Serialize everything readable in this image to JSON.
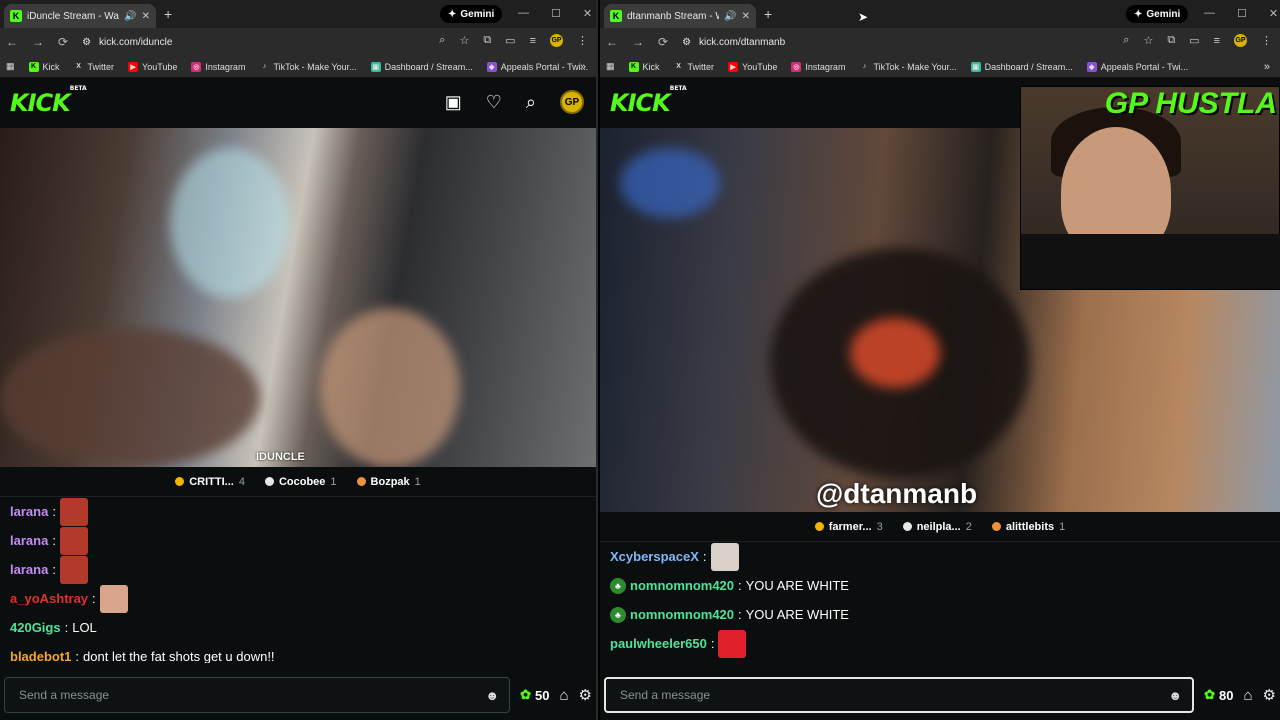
{
  "left": {
    "tab_title": "iDuncle Stream - Watch Live",
    "url": "kick.com/iduncle",
    "gemini": "Gemini",
    "bookmarks": [
      "Kick",
      "Twitter",
      "YouTube",
      "Instagram",
      "TikTok - Make Your...",
      "Dashboard / Stream...",
      "Appeals Portal - Twi..."
    ],
    "logo": "KICK",
    "logo_tag": "BETA",
    "avatar": "GP",
    "video_tag": "IDUNCLE",
    "supporters": [
      {
        "name": "CRITTI...",
        "count": "4",
        "color": "#f5b400"
      },
      {
        "name": "Cocobee",
        "count": "1",
        "color": "#e8e8e8"
      },
      {
        "name": "Bozpak",
        "count": "1",
        "color": "#f0903a"
      }
    ],
    "chat": [
      {
        "user": "larana",
        "text": "",
        "color": "#c48cf5",
        "emote": "#b33a2a"
      },
      {
        "user": "larana",
        "text": "",
        "color": "#c48cf5",
        "emote": "#b33a2a"
      },
      {
        "user": "larana",
        "text": "",
        "color": "#c48cf5",
        "emote": "#b33a2a"
      },
      {
        "user": "a_yoAshtray",
        "text": "",
        "color": "#e0302f",
        "emote": "#d9a58c"
      },
      {
        "user": "420Gigs",
        "text": "LOL",
        "color": "#4fe39a",
        "emote": ""
      },
      {
        "user": "bladebot1",
        "text": "dont let the fat shots get u down!!",
        "color": "#f5a623",
        "emote": ""
      }
    ],
    "input_placeholder": "Send a message",
    "points": "50"
  },
  "right": {
    "tab_title": "dtanmanb Stream - Watch Live",
    "url": "kick.com/dtanmanb",
    "gemini": "Gemini",
    "bookmarks": [
      "Kick",
      "Twitter",
      "YouTube",
      "Instagram",
      "TikTok - Make Your...",
      "Dashboard / Stream...",
      "Appeals Portal - Twi..."
    ],
    "logo": "KICK",
    "logo_tag": "BETA",
    "cam_title": "GP HUSTLA",
    "video_tag": "@dtanmanb",
    "supporters": [
      {
        "name": "farmer...",
        "count": "3",
        "color": "#f5b400"
      },
      {
        "name": "neilpla...",
        "count": "2",
        "color": "#e8e8e8"
      },
      {
        "name": "alittlebits",
        "count": "1",
        "color": "#f0903a"
      }
    ],
    "chat": [
      {
        "user": "XcyberspaceX",
        "text": "",
        "color": "#7fb8f5",
        "emote": "#d9d0c8",
        "mod": false
      },
      {
        "user": "nomnomnom420",
        "text": "YOU ARE WHITE",
        "color": "#4fe39a",
        "emote": "",
        "mod": true
      },
      {
        "user": "nomnomnom420",
        "text": "YOU ARE WHITE",
        "color": "#4fe39a",
        "emote": "",
        "mod": true
      },
      {
        "user": "paulwheeler650",
        "text": "",
        "color": "#4fe39a",
        "emote": "#e0202a",
        "mod": false
      }
    ],
    "input_placeholder": "Send a message",
    "points": "80"
  },
  "colors": {
    "kick_green": "#53fc18",
    "bg": "#0b0e0f"
  }
}
